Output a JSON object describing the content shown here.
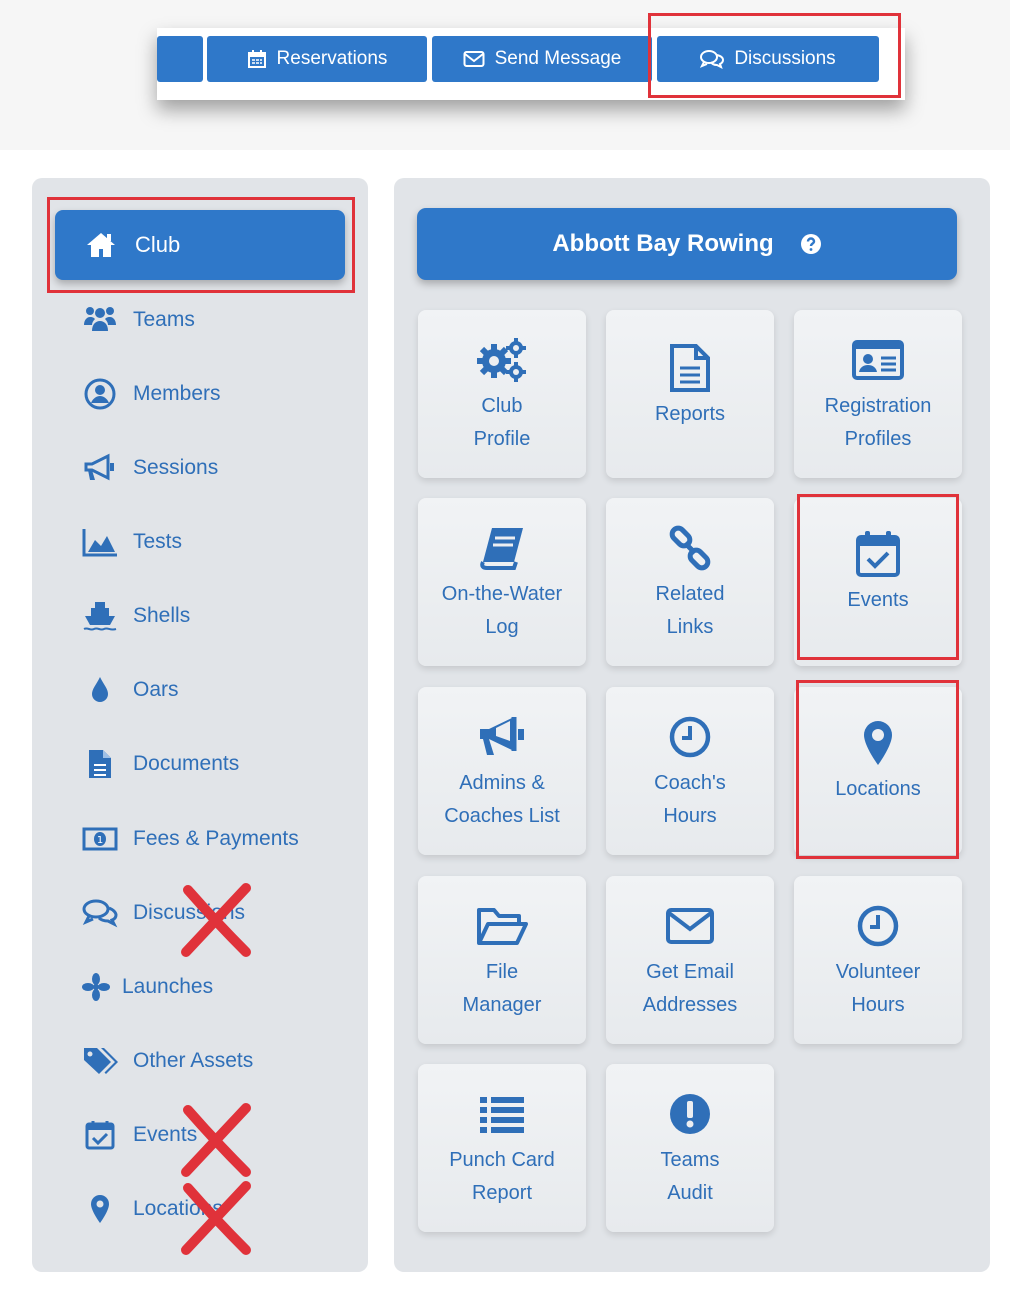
{
  "topbar": {
    "tabs": [
      {
        "label": "Reservations",
        "icon": "calendar-icon"
      },
      {
        "label": "Send Message",
        "icon": "envelope-icon"
      },
      {
        "label": "Discussions",
        "icon": "comments-icon"
      }
    ]
  },
  "sidebar": {
    "active": {
      "label": "Club",
      "icon": "home-icon"
    },
    "items": [
      {
        "label": "Teams",
        "icon": "users-icon"
      },
      {
        "label": "Members",
        "icon": "user-circle-icon"
      },
      {
        "label": "Sessions",
        "icon": "megaphone-icon"
      },
      {
        "label": "Tests",
        "icon": "area-chart-icon"
      },
      {
        "label": "Shells",
        "icon": "ship-icon"
      },
      {
        "label": "Oars",
        "icon": "drop-icon"
      },
      {
        "label": "Documents",
        "icon": "document-icon"
      },
      {
        "label": "Fees & Payments",
        "icon": "money-icon"
      },
      {
        "label": "Discussions",
        "icon": "comments-icon"
      },
      {
        "label": "Launches",
        "icon": "fan-icon"
      },
      {
        "label": "Other Assets",
        "icon": "tags-icon"
      },
      {
        "label": "Events",
        "icon": "calendar-check-icon"
      },
      {
        "label": "Locations",
        "icon": "map-marker-icon"
      }
    ]
  },
  "main": {
    "title": "Abbott Bay Rowing",
    "help_icon": "question-circle-icon",
    "tiles": [
      {
        "line1": "Club",
        "line2": "Profile",
        "icon": "gears-icon"
      },
      {
        "line1": "Reports",
        "line2": "",
        "icon": "file-text-icon"
      },
      {
        "line1": "Registration",
        "line2": "Profiles",
        "icon": "id-card-icon"
      },
      {
        "line1": "On-the-Water",
        "line2": "Log",
        "icon": "book-icon"
      },
      {
        "line1": "Related",
        "line2": "Links",
        "icon": "link-icon"
      },
      {
        "line1": "Events",
        "line2": "",
        "icon": "calendar-check-icon"
      },
      {
        "line1": "Admins &",
        "line2": "Coaches List",
        "icon": "megaphone-icon"
      },
      {
        "line1": "Coach's",
        "line2": "Hours",
        "icon": "clock-icon"
      },
      {
        "line1": "Locations",
        "line2": "",
        "icon": "map-marker-icon"
      },
      {
        "line1": "File",
        "line2": "Manager",
        "icon": "folder-open-icon"
      },
      {
        "line1": "Get Email",
        "line2": "Addresses",
        "icon": "envelope-icon"
      },
      {
        "line1": "Volunteer",
        "line2": "Hours",
        "icon": "clock-icon"
      },
      {
        "line1": "Punch Card",
        "line2": "Report",
        "icon": "list-icon"
      },
      {
        "line1": "Teams",
        "line2": "Audit",
        "icon": "exclamation-circle-icon"
      }
    ]
  },
  "colors": {
    "brand_blue": "#2f78c9",
    "text_blue": "#2f6fb8",
    "panel_gray": "#e1e4e8",
    "highlight_red": "#e0323a"
  }
}
